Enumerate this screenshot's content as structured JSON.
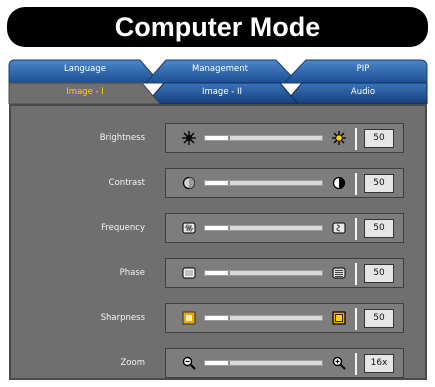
{
  "title": "Computer Mode",
  "tabs_top": [
    {
      "label": "Language"
    },
    {
      "label": "Management"
    },
    {
      "label": "PIP"
    }
  ],
  "tabs_bottom": [
    {
      "label": "Image - I",
      "active": true
    },
    {
      "label": "Image - II",
      "active": false
    },
    {
      "label": "Audio",
      "active": false
    }
  ],
  "colors": {
    "active_tab_text": "#ffd200",
    "tab_blue": "#2b63a8",
    "panel": "#6f6f6f"
  },
  "settings": [
    {
      "label": "Brightness",
      "value": "50",
      "level": 0.2,
      "icon_left": "brightness-low-icon",
      "icon_right": "brightness-high-icon"
    },
    {
      "label": "Contrast",
      "value": "50",
      "level": 0.2,
      "icon_left": "contrast-low-icon",
      "icon_right": "contrast-high-icon"
    },
    {
      "label": "Frequency",
      "value": "50",
      "level": 0.2,
      "icon_left": "frequency-low-icon",
      "icon_right": "frequency-high-icon"
    },
    {
      "label": "Phase",
      "value": "50",
      "level": 0.2,
      "icon_left": "phase-low-icon",
      "icon_right": "phase-high-icon"
    },
    {
      "label": "Sharpness",
      "value": "50",
      "level": 0.2,
      "icon_left": "sharpness-low-icon",
      "icon_right": "sharpness-high-icon"
    },
    {
      "label": "Zoom",
      "value": "16x",
      "level": 0.2,
      "icon_left": "zoom-out-icon",
      "icon_right": "zoom-in-icon"
    }
  ]
}
